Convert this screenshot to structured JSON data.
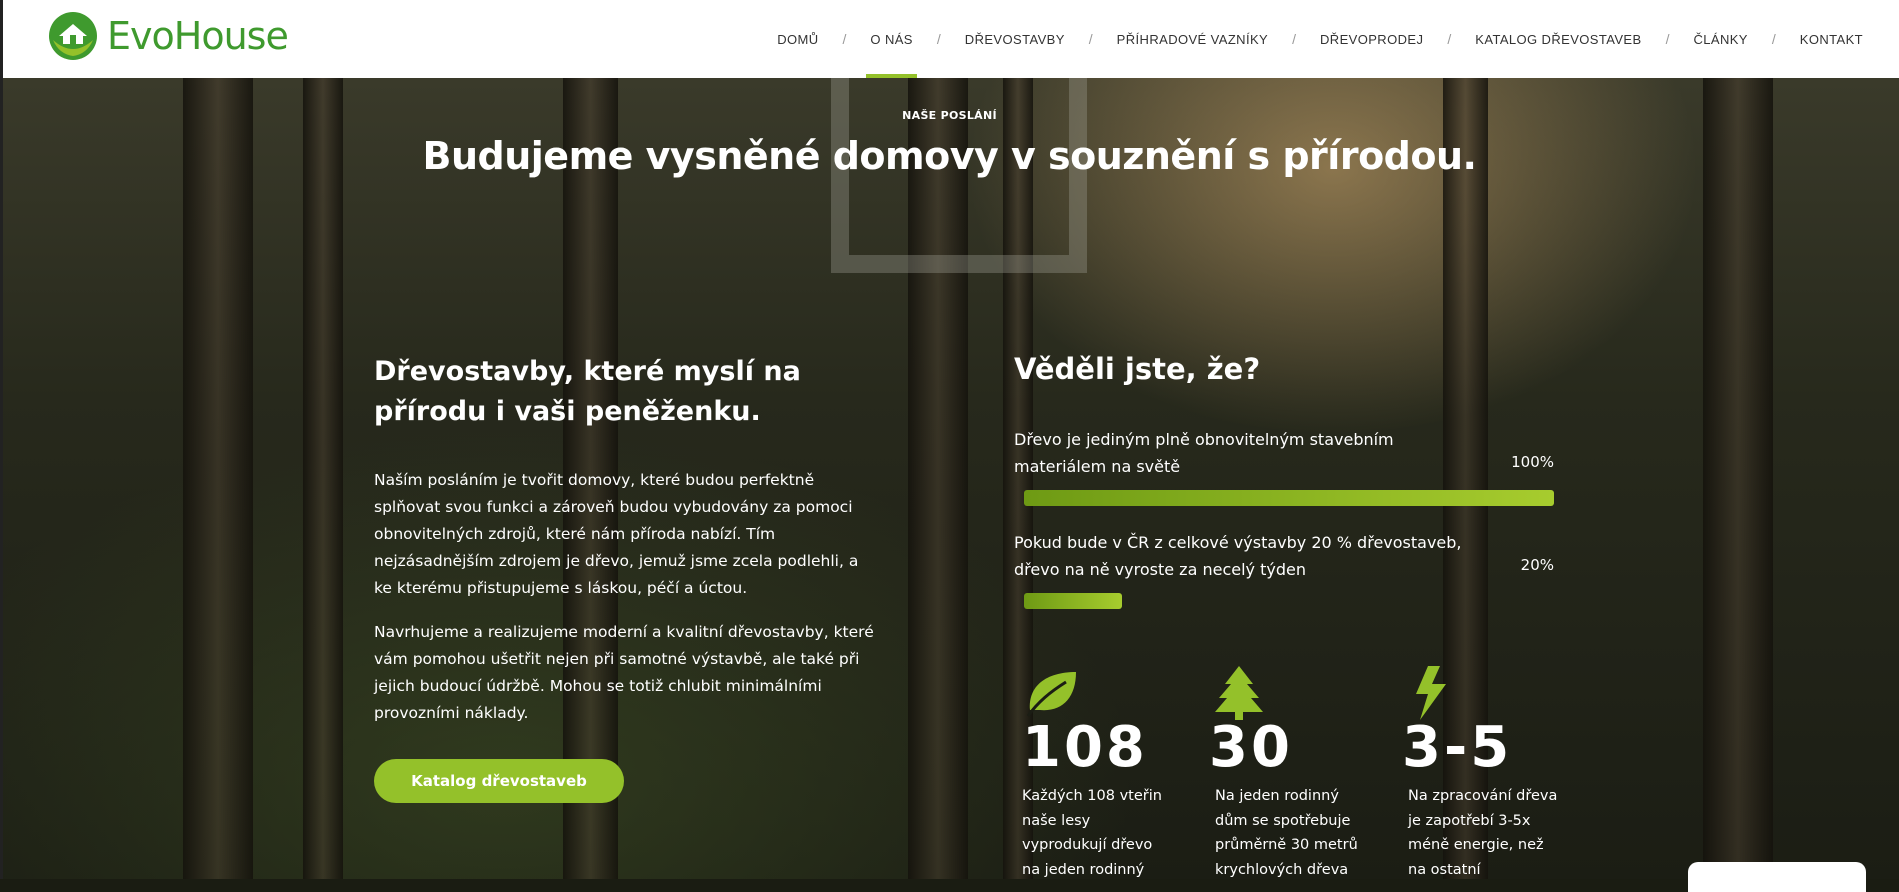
{
  "brand": {
    "name": "EvoHouse",
    "accent": "#94c12a",
    "logo_color": "#3f9a2e"
  },
  "nav": {
    "items": [
      {
        "label": "DOMŮ",
        "active": false
      },
      {
        "label": "O NÁS",
        "active": true
      },
      {
        "label": "DŘEVOSTAVBY",
        "active": false
      },
      {
        "label": "PŘÍHRADOVÉ VAZNÍKY",
        "active": false
      },
      {
        "label": "DŘEVOPRODEJ",
        "active": false
      },
      {
        "label": "KATALOG DŘEVOSTAVEB",
        "active": false
      },
      {
        "label": "ČLÁNKY",
        "active": false
      },
      {
        "label": "KONTAKT",
        "active": false
      }
    ],
    "separator": "/"
  },
  "hero": {
    "eyebrow": "NAŠE POSLÁNÍ",
    "headline": "Budujeme vysněné domovy v souznění s přírodou."
  },
  "left": {
    "title": "Dřevostavby, které myslí na přírodu i vaši peněženku.",
    "paragraph1": "Naším posláním je tvořit domovy, které budou perfektně splňovat svou funkci a zároveň budou vybudovány za pomoci obnovitelných zdrojů, které nám příroda nabízí. Tím nejzásadnějším zdrojem je dřevo, jemuž jsme zcela podlehli, a ke kterému přistupujeme s láskou, péčí a úctou.",
    "paragraph2": "Navrhujeme a realizujeme moderní a kvalitní dřevostavby, které vám pomohou ušetřit nejen při samotné výstavbě, ale také při jejich budoucí údržbě. Mohou se totiž chlubit minimálními provozními náklady.",
    "cta_label": "Katalog dřevostaveb"
  },
  "right": {
    "title": "Věděli jste, že?",
    "facts": [
      {
        "text": "Dřevo je jediným plně obnovitelným stavebním materiálem na světě",
        "percent_label": "100%",
        "value": 100
      },
      {
        "text": "Pokud bude v ČR z celkové výstavby 20 % dřevostaveb, dřevo na ně vyroste za necelý týden",
        "percent_label": "20%",
        "value": 20
      }
    ],
    "stats": [
      {
        "icon": "leaf-icon",
        "number": "108",
        "text": "Každých 108 vteřin naše lesy vyprodukují dřevo na jeden rodinný"
      },
      {
        "icon": "tree-icon",
        "number": "30",
        "text": "Na jeden rodinný dům se spotřebuje průměrně 30 metrů krychlových dřeva"
      },
      {
        "icon": "lightning-icon",
        "number": "3-5",
        "text": "Na zpracování dřeva je zapotřebí 3-5x méně energie, než na ostatní"
      }
    ]
  }
}
